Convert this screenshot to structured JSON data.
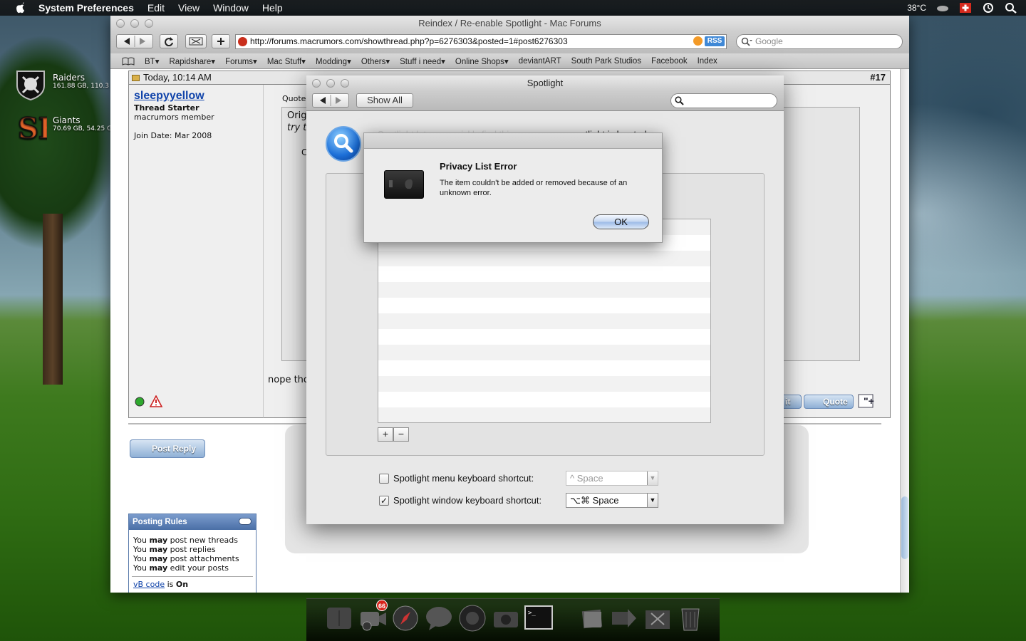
{
  "menubar": {
    "app_name": "System Preferences",
    "items": [
      "Edit",
      "View",
      "Window",
      "Help"
    ],
    "temperature": "38°C"
  },
  "desktop": {
    "items": [
      {
        "name": "Raiders",
        "info": "161.88 GB, 110.3"
      },
      {
        "name": "Giants",
        "info": "70.69 GB, 54.25 G"
      }
    ]
  },
  "browser": {
    "title": "Reindex / Re-enable Spotlight - Mac Forums",
    "url": "http://forums.macrumors.com/showthread.php?p=6276303&posted=1#post6276303",
    "rss_label": "RSS",
    "search_placeholder": "Google",
    "bookmarks": [
      "BT▾",
      "Rapidshare▾",
      "Forums▾",
      "Mac Stuff▾",
      "Modding▾",
      "Others▾",
      "Stuff i need▾",
      "Online Shops▾",
      "deviantART",
      "South Park Studios",
      "Facebook",
      "Index"
    ]
  },
  "post": {
    "date": "Today, 10:14 AM",
    "number": "#17",
    "username": "sleepyyellow",
    "user_title": "Thread Starter",
    "user_rank": "macrumors member",
    "join_date": "Join Date: Mar 2008",
    "quote_label": "Quote",
    "quote_text_1": "Orig",
    "quote_text_2": "try t",
    "quote_text_3": "C",
    "reply_text": "nope tho",
    "edit_label": "it",
    "quote_button": "Quote",
    "post_reply_button": "Post Reply"
  },
  "posting_rules": {
    "title": "Posting Rules",
    "rules": [
      {
        "pre": "You ",
        "bold": "may",
        "post": " post new threads"
      },
      {
        "pre": "You ",
        "bold": "may",
        "post": " post replies"
      },
      {
        "pre": "You ",
        "bold": "may",
        "post": " post attachments"
      },
      {
        "pre": "You ",
        "bold": "may",
        "post": " edit your posts"
      }
    ],
    "vb_code": "vB code",
    "vb_is": " is ",
    "vb_state": "On"
  },
  "spotlight": {
    "title": "Spotlight",
    "show_all": "Show All",
    "description": "Spotlight lets you quickly find things on your computer. Spotlight is located",
    "description_visible": "Spotlight lets you quickly find thi",
    "description_tail": "otlight is located",
    "menu_shortcut_label": "Spotlight menu keyboard shortcut:",
    "menu_shortcut_value": "^ Space",
    "menu_shortcut_checked": false,
    "window_shortcut_label": "Spotlight window keyboard shortcut:",
    "window_shortcut_value": "⌥⌘ Space",
    "window_shortcut_checked": true,
    "add_label": "+",
    "remove_label": "−"
  },
  "alert": {
    "title": "Privacy List Error",
    "message": "The item couldn't be added or removed because of an unknown error.",
    "ok_label": "OK"
  },
  "dock": {
    "badge": "66"
  }
}
